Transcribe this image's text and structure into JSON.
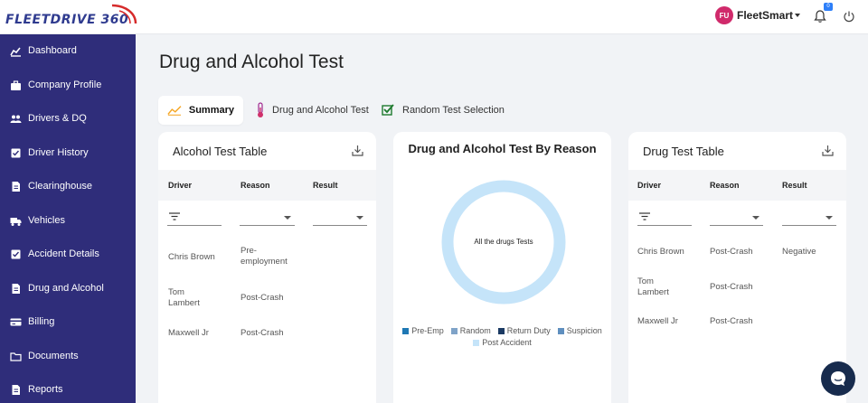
{
  "brand": {
    "logo_text": "FLEETDRIVE 360"
  },
  "header": {
    "user_initials": "FU",
    "user_name": "FleetSmart",
    "notification_count": "0",
    "accent_color": "#2d7ff9"
  },
  "sidebar": {
    "background": "#2f2d7a",
    "items": [
      {
        "label": "Dashboard",
        "icon": "chart-icon"
      },
      {
        "label": "Company Profile",
        "icon": "briefcase-icon"
      },
      {
        "label": "Drivers & DQ",
        "icon": "users-icon"
      },
      {
        "label": "Driver History",
        "icon": "checklist-icon"
      },
      {
        "label": "Clearinghouse",
        "icon": "document-icon"
      },
      {
        "label": "Vehicles",
        "icon": "truck-icon"
      },
      {
        "label": "Accident Details",
        "icon": "checklist-icon"
      },
      {
        "label": "Drug and Alcohol",
        "icon": "document-icon"
      },
      {
        "label": "Billing",
        "icon": "billing-icon"
      },
      {
        "label": "Documents",
        "icon": "folder-icon"
      },
      {
        "label": "Reports",
        "icon": "document-icon"
      }
    ]
  },
  "page": {
    "title": "Drug and Alcohol Test"
  },
  "tabs": [
    {
      "label": "Summary",
      "icon": "trend-icon",
      "active": true
    },
    {
      "label": "Drug and Alcohol Test",
      "icon": "thermometer-icon",
      "active": false
    },
    {
      "label": "Random Test Selection",
      "icon": "checkbox-icon",
      "active": false
    }
  ],
  "alcohol_table": {
    "title": "Alcohol Test Table",
    "columns": [
      "Driver",
      "Reason",
      "Result"
    ],
    "rows": [
      {
        "driver": "Chris Brown",
        "reason": "Pre-\nemployment",
        "result": ""
      },
      {
        "driver": "Tom\nLambert",
        "reason": "Post-Crash",
        "result": ""
      },
      {
        "driver": "Maxwell Jr",
        "reason": "Post-Crash",
        "result": ""
      }
    ]
  },
  "drug_table": {
    "title": "Drug Test Table",
    "columns": [
      "Driver",
      "Reason",
      "Result"
    ],
    "rows": [
      {
        "driver": "Chris Brown",
        "reason": "Post-Crash",
        "result": "Negative"
      },
      {
        "driver": "Tom\nLambert",
        "reason": "Post-Crash",
        "result": ""
      },
      {
        "driver": "Maxwell Jr",
        "reason": "Post-Crash",
        "result": ""
      }
    ]
  },
  "chart_data": {
    "type": "pie",
    "title": "Drug and Alcohol Test By Reason",
    "center_label": "All the drugs Tests",
    "legend": [
      {
        "name": "Pre-Emp",
        "color": "#1f78b4"
      },
      {
        "name": "Random",
        "color": "#7fa3c8"
      },
      {
        "name": "Return Duty",
        "color": "#1b3a63"
      },
      {
        "name": "Suspicion",
        "color": "#5f8fbf"
      },
      {
        "name": "Post Accident",
        "color": "#c5e4f9"
      }
    ],
    "values": [
      0,
      0,
      0,
      0,
      1
    ],
    "legend_position": "bottom"
  }
}
